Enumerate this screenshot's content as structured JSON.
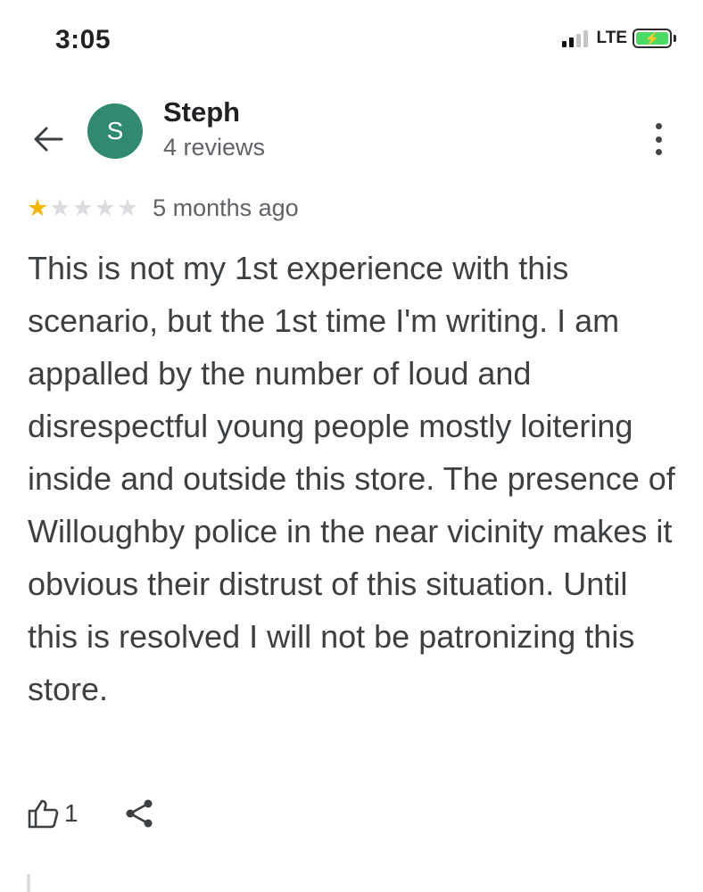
{
  "status": {
    "time": "3:05",
    "network": "LTE"
  },
  "reviewer": {
    "initial": "S",
    "name": "Steph",
    "review_count": "4 reviews"
  },
  "review": {
    "rating": 1,
    "rating_max": 5,
    "time_ago": "5 months ago",
    "text": "This is not my 1st experience with this scenario, but the 1st time I'm writing. I am appalled by the number of loud and disrespectful young people mostly loitering inside and outside this store. The presence of Willoughby police in the near vicinity makes it obvious their distrust of this situation. Until this is resolved I will not be patronizing this store."
  },
  "actions": {
    "like_count": "1"
  },
  "colors": {
    "avatar": "#2f8a6f",
    "star_on": "#f5b400",
    "star_off": "#dadce0",
    "battery": "#4cd964"
  },
  "icons": {
    "back": "arrow-left-icon",
    "more": "more-vert-icon",
    "like": "thumb-up-icon",
    "share": "share-icon"
  }
}
